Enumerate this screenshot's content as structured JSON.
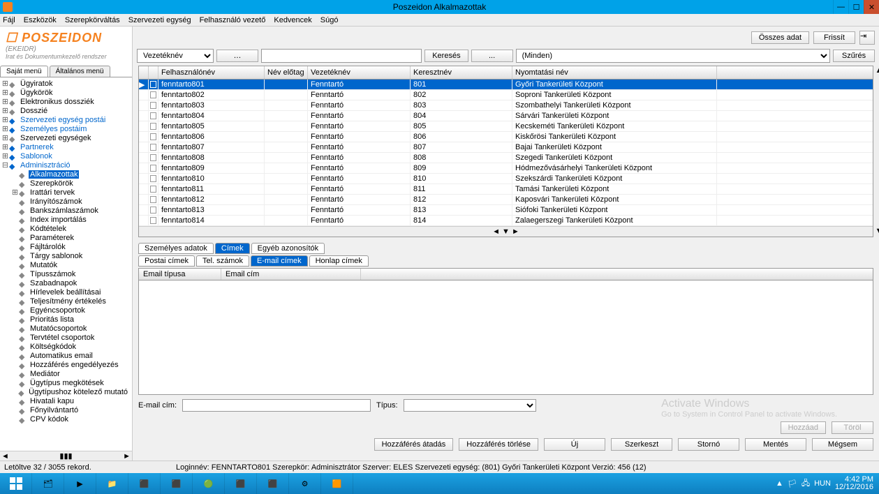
{
  "window": {
    "title": "Poszeidon Alkalmazottak"
  },
  "menu": [
    "Fájl",
    "Eszközök",
    "Szerepkörváltás",
    "Szervezeti egység",
    "Felhasználó vezető",
    "Kedvencek",
    "Súgó"
  ],
  "logo": {
    "brand": "POSZEIDON",
    "sub1": "(EKEIDR)",
    "sub2": "Irat és Dokumentumkezelő rendszer"
  },
  "sidetabs": {
    "own": "Saját menü",
    "general": "Általános menü"
  },
  "tree": [
    {
      "lvl": 0,
      "exp": "⊞",
      "label": "Ügyiratok"
    },
    {
      "lvl": 0,
      "exp": "⊞",
      "label": "Ügykörök"
    },
    {
      "lvl": 0,
      "exp": "⊞",
      "label": "Elektronikus dossziék"
    },
    {
      "lvl": 0,
      "exp": "⊞",
      "label": "Dosszié"
    },
    {
      "lvl": 0,
      "exp": "⊞",
      "label": "Szervezeti egység postái",
      "blue": true
    },
    {
      "lvl": 0,
      "exp": "⊞",
      "label": "Személyes postáim",
      "blue": true
    },
    {
      "lvl": 0,
      "exp": "⊞",
      "label": "Szervezeti egységek"
    },
    {
      "lvl": 0,
      "exp": "⊞",
      "label": "Partnerek",
      "blue": true
    },
    {
      "lvl": 0,
      "exp": "⊞",
      "label": "Sablonok",
      "blue": true
    },
    {
      "lvl": 0,
      "exp": "⊟",
      "label": "Adminisztráció",
      "blue": true
    },
    {
      "lvl": 1,
      "exp": "",
      "label": "Alkalmazottak",
      "sel": true
    },
    {
      "lvl": 1,
      "exp": "",
      "label": "Szerepkörök"
    },
    {
      "lvl": 1,
      "exp": "⊞",
      "label": "Irattári tervek"
    },
    {
      "lvl": 1,
      "exp": "",
      "label": "Irányítószámok"
    },
    {
      "lvl": 1,
      "exp": "",
      "label": "Bankszámlaszámok"
    },
    {
      "lvl": 1,
      "exp": "",
      "label": "Index importálás"
    },
    {
      "lvl": 1,
      "exp": "",
      "label": "Kódtételek"
    },
    {
      "lvl": 1,
      "exp": "",
      "label": "Paraméterek"
    },
    {
      "lvl": 1,
      "exp": "",
      "label": "Fájltárolók"
    },
    {
      "lvl": 1,
      "exp": "",
      "label": "Tárgy sablonok"
    },
    {
      "lvl": 1,
      "exp": "",
      "label": "Mutatók"
    },
    {
      "lvl": 1,
      "exp": "",
      "label": "Típusszámok"
    },
    {
      "lvl": 1,
      "exp": "",
      "label": "Szabadnapok"
    },
    {
      "lvl": 1,
      "exp": "",
      "label": "Hírlevelek beállításai"
    },
    {
      "lvl": 1,
      "exp": "",
      "label": "Teljesítmény értékelés"
    },
    {
      "lvl": 1,
      "exp": "",
      "label": "Egyéncsoportok"
    },
    {
      "lvl": 1,
      "exp": "",
      "label": "Prioritás lista"
    },
    {
      "lvl": 1,
      "exp": "",
      "label": "Mutatócsoportok"
    },
    {
      "lvl": 1,
      "exp": "",
      "label": "Tervtétel csoportok"
    },
    {
      "lvl": 1,
      "exp": "",
      "label": "Költségkódok"
    },
    {
      "lvl": 1,
      "exp": "",
      "label": "Automatikus email"
    },
    {
      "lvl": 1,
      "exp": "",
      "label": "Hozzáférés engedélyezés"
    },
    {
      "lvl": 1,
      "exp": "",
      "label": "Mediátor"
    },
    {
      "lvl": 1,
      "exp": "",
      "label": "Ügytípus megkötések"
    },
    {
      "lvl": 1,
      "exp": "",
      "label": "Ügytípushoz kötelező mutató"
    },
    {
      "lvl": 1,
      "exp": "",
      "label": "Hivatali kapu"
    },
    {
      "lvl": 1,
      "exp": "",
      "label": "Főnyilvántartó"
    },
    {
      "lvl": 1,
      "exp": "",
      "label": "CPV kódok"
    }
  ],
  "toolbar": {
    "allData": "Összes adat",
    "refresh": "Frissít"
  },
  "search": {
    "field": "Vezetéknév",
    "searchBtn": "Keresés",
    "dots": "...",
    "filter": "(Minden)",
    "filterBtn": "Szűrés",
    "ellipsis": "…"
  },
  "columns": {
    "user": "Felhasználónév",
    "prefix": "Név előtag",
    "last": "Vezetéknév",
    "first": "Keresztnév",
    "print": "Nyomtatási név"
  },
  "rows": [
    {
      "u": "fenntarto801",
      "l": "Fenntartó",
      "f": "801",
      "p": "Győri Tankerületi Központ",
      "sel": true
    },
    {
      "u": "fenntarto802",
      "l": "Fenntartó",
      "f": "802",
      "p": "Soproni Tankerületi Központ"
    },
    {
      "u": "fenntarto803",
      "l": "Fenntartó",
      "f": "803",
      "p": "Szombathelyi Tankerületi Központ"
    },
    {
      "u": "fenntarto804",
      "l": "Fenntartó",
      "f": "804",
      "p": "Sárvári Tankerületi Központ"
    },
    {
      "u": "fenntarto805",
      "l": "Fenntartó",
      "f": "805",
      "p": "Kecskeméti Tankerületi Központ"
    },
    {
      "u": "fenntarto806",
      "l": "Fenntartó",
      "f": "806",
      "p": "Kiskőrösi Tankerületi Központ"
    },
    {
      "u": "fenntarto807",
      "l": "Fenntartó",
      "f": "807",
      "p": "Bajai Tankerületi Központ"
    },
    {
      "u": "fenntarto808",
      "l": "Fenntartó",
      "f": "808",
      "p": "Szegedi Tankerületi Központ"
    },
    {
      "u": "fenntarto809",
      "l": "Fenntartó",
      "f": "809",
      "p": "Hódmezővásárhelyi Tankerületi Központ"
    },
    {
      "u": "fenntarto810",
      "l": "Fenntartó",
      "f": "810",
      "p": "Szekszárdi Tankerületi Központ"
    },
    {
      "u": "fenntarto811",
      "l": "Fenntartó",
      "f": "811",
      "p": "Tamási Tankerületi Központ"
    },
    {
      "u": "fenntarto812",
      "l": "Fenntartó",
      "f": "812",
      "p": "Kaposvári Tankerületi Központ"
    },
    {
      "u": "fenntarto813",
      "l": "Fenntartó",
      "f": "813",
      "p": "Siófoki Tankerületi Központ"
    },
    {
      "u": "fenntarto814",
      "l": "Fenntartó",
      "f": "814",
      "p": "Zalaegerszegi Tankerületi Központ"
    }
  ],
  "detailTabs1": {
    "personal": "Személyes adatok",
    "addresses": "Címek",
    "other": "Egyéb azonosítók"
  },
  "detailTabs2": {
    "postal": "Postai címek",
    "phone": "Tel. számok",
    "email": "E-mail címek",
    "web": "Honlap címek"
  },
  "detailCols": {
    "type": "Email típusa",
    "addr": "Email cím"
  },
  "emailForm": {
    "emailLabel": "E-mail cím:",
    "typeLabel": "Típus:"
  },
  "detailBtns": {
    "add": "Hozzáad",
    "del": "Töröl"
  },
  "actions": {
    "handover": "Hozzáférés átadás",
    "delAccess": "Hozzáférés törlése",
    "new": "Új",
    "edit": "Szerkeszt",
    "cancel": "Stornó",
    "save": "Mentés",
    "no": "Mégsem"
  },
  "watermark": {
    "l1": "Activate Windows",
    "l2": "Go to System in Control Panel to activate Windows."
  },
  "status": {
    "records": "Letöltve 32 / 3055 rekord.",
    "info": "Loginnév: FENNTARTO801   Szerepkör: Adminisztrátor   Szerver: ELES   Szervezeti egység: (801) Győri Tankerületi Központ   Verzió: 456 (12)"
  },
  "taskbar": {
    "lang": "HUN",
    "time": "4:42 PM",
    "date": "12/12/2016"
  }
}
